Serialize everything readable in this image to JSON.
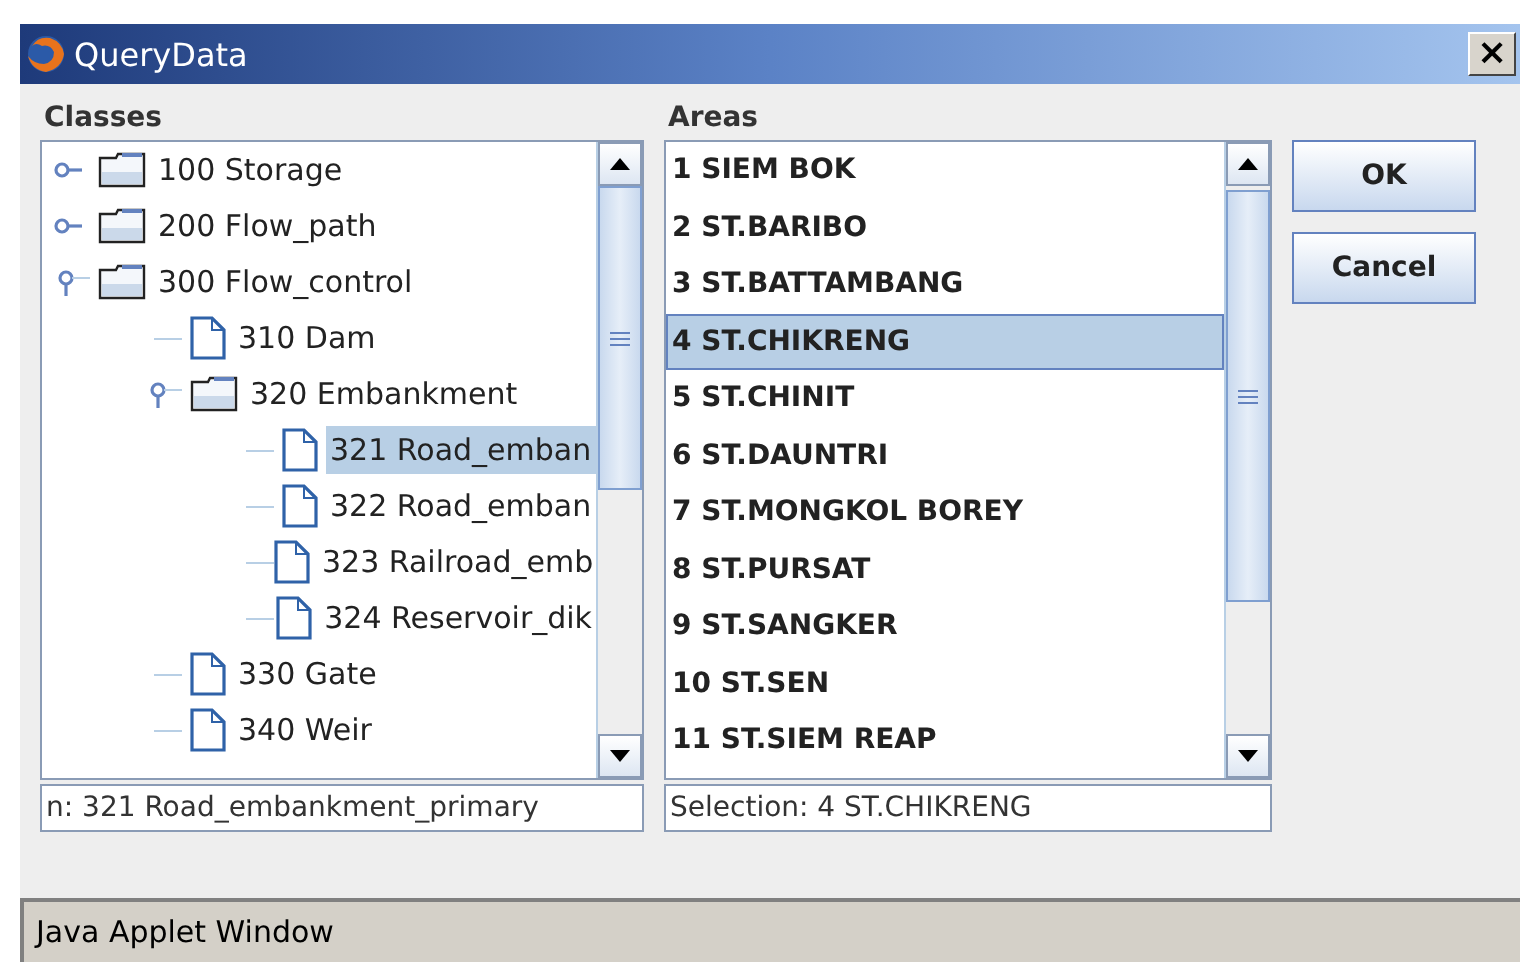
{
  "window": {
    "title": "QueryData",
    "close": "×"
  },
  "classes": {
    "label": "Classes",
    "tree": [
      {
        "label": "100 Storage",
        "kind": "folder",
        "expanded": false,
        "selected": false
      },
      {
        "label": "200 Flow_path",
        "kind": "folder",
        "expanded": false,
        "selected": false
      },
      {
        "label": "300 Flow_control",
        "kind": "folder",
        "expanded": true,
        "selected": false,
        "children": [
          {
            "label": "310 Dam",
            "kind": "leaf",
            "selected": false
          },
          {
            "label": "320 Embankment",
            "kind": "folder",
            "expanded": true,
            "selected": false,
            "children": [
              {
                "label": "321 Road_emban",
                "kind": "leaf",
                "selected": true
              },
              {
                "label": "322 Road_emban",
                "kind": "leaf",
                "selected": false
              },
              {
                "label": "323 Railroad_emb",
                "kind": "leaf",
                "selected": false
              },
              {
                "label": "324 Reservoir_dik",
                "kind": "leaf",
                "selected": false
              }
            ]
          },
          {
            "label": "330 Gate",
            "kind": "leaf",
            "selected": false
          },
          {
            "label": "340 Weir",
            "kind": "leaf",
            "selected": false
          }
        ]
      }
    ],
    "field": "n: 321 Road_embankment_primary"
  },
  "areas": {
    "label": "Areas",
    "items": [
      {
        "label": "1 SIEM BOK",
        "selected": false
      },
      {
        "label": "2 ST.BARIBO",
        "selected": false
      },
      {
        "label": "3 ST.BATTAMBANG",
        "selected": false
      },
      {
        "label": "4 ST.CHIKRENG",
        "selected": true
      },
      {
        "label": "5 ST.CHINIT",
        "selected": false
      },
      {
        "label": "6 ST.DAUNTRI",
        "selected": false
      },
      {
        "label": "7 ST.MONGKOL BOREY",
        "selected": false
      },
      {
        "label": "8 ST.PURSAT",
        "selected": false
      },
      {
        "label": "9 ST.SANGKER",
        "selected": false
      },
      {
        "label": "10 ST.SEN",
        "selected": false
      },
      {
        "label": "11 ST.SIEM REAP",
        "selected": false
      }
    ],
    "field": "Selection: 4 ST.CHIKRENG"
  },
  "buttons": [
    "OK",
    "Cancel"
  ],
  "status_bar": "Java Applet Window"
}
